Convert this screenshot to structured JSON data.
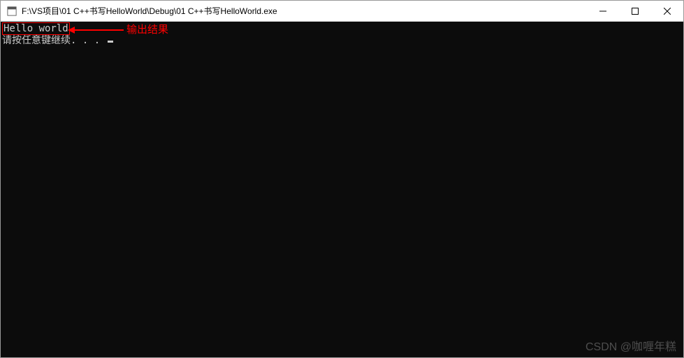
{
  "titlebar": {
    "title": "F:\\VS项目\\01 C++书写HelloWorld\\Debug\\01 C++书写HelloWorld.exe",
    "minimize": "—",
    "maximize": "□",
    "close": "✕"
  },
  "console": {
    "line1": "Hello world",
    "line2": "请按任意键继续. . . ",
    "annotation": "输出结果"
  },
  "watermark": "CSDN @咖喱年糕"
}
